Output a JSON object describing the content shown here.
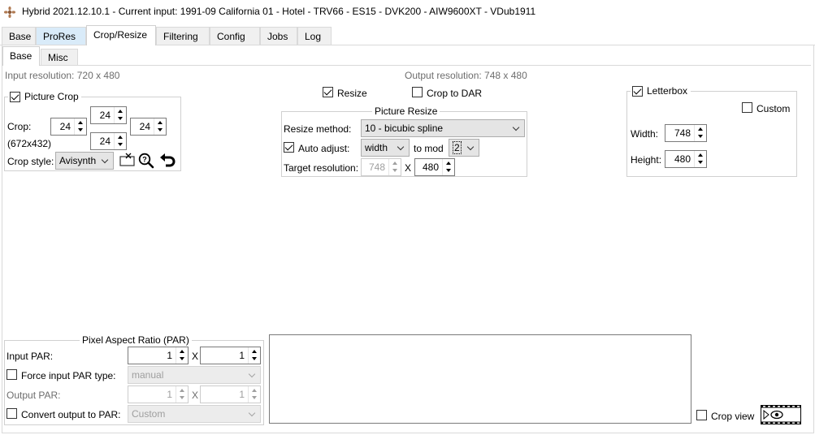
{
  "window": {
    "title": "Hybrid 2021.12.10.1 - Current input: 1991-09 California 01 - Hotel - TRV66 - ES15 - DVK200 - AIW9600XT - VDub1911"
  },
  "main_tabs": [
    "Base",
    "ProRes",
    "Crop/Resize",
    "Filtering",
    "Config",
    "Jobs",
    "Log"
  ],
  "sub_tabs": [
    "Base",
    "Misc"
  ],
  "input_resolution": "Input resolution: 720 x 480",
  "output_resolution": "Output resolution: 748 x 480",
  "picture_crop": {
    "label": "Picture Crop",
    "crop_label": "Crop:",
    "top": "24",
    "left": "24",
    "right": "24",
    "bottom": "24",
    "size": "(672x432)",
    "style_label": "Crop style:",
    "style_value": "Avisynth"
  },
  "resize": {
    "resize_label": "Resize",
    "crop_to_dar_label": "Crop to DAR",
    "group_title": "Picture Resize",
    "method_label": "Resize method:",
    "method_value": "10 - bicubic spline",
    "auto_adjust_label": "Auto adjust:",
    "auto_adjust_value": "width",
    "to_mod_label": "to mod",
    "mod_value": "2",
    "target_label": "Target resolution:",
    "target_w": "748",
    "x_sep": "X",
    "target_h": "480"
  },
  "letterbox": {
    "label": "Letterbox",
    "custom_label": "Custom",
    "width_label": "Width:",
    "width_value": "748",
    "height_label": "Height:",
    "height_value": "480"
  },
  "par": {
    "group_title": "Pixel Aspect Ratio (PAR)",
    "input_label": "Input PAR:",
    "input_a": "1",
    "input_b": "1",
    "x_sep": "X",
    "force_label": "Force input PAR type:",
    "force_value": "manual",
    "output_label": "Output PAR:",
    "output_a": "1",
    "output_b": "1",
    "convert_label": "Convert output to PAR:",
    "convert_value": "Custom"
  },
  "crop_view_label": "Crop view"
}
